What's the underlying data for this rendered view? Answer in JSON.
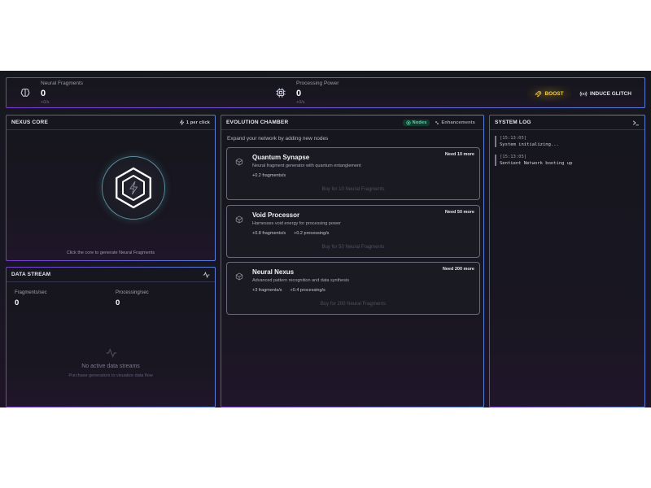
{
  "stats": {
    "fragments": {
      "label": "Neural Fragments",
      "value": "0",
      "rate": "+0/s",
      "icon": "brain-icon"
    },
    "power": {
      "label": "Processing Power",
      "value": "0",
      "rate": "+0/s",
      "icon": "cpu-icon"
    }
  },
  "actions": {
    "boost": "BOOST",
    "glitch": "INDUCE GLITCH"
  },
  "nexus_core": {
    "title": "NEXUS CORE",
    "per_click": "1 per click",
    "hint": "Click the core to generate Neural Fragments"
  },
  "data_stream": {
    "title": "DATA STREAM",
    "fragments_label": "Fragments/sec",
    "fragments_value": "0",
    "processing_label": "Processing/sec",
    "processing_value": "0",
    "empty_title": "No active data streams",
    "empty_sub": "Purchase generators to visualize data flow"
  },
  "evolution": {
    "title": "EVOLUTION CHAMBER",
    "tabs": {
      "nodes": "Nodes",
      "enhancements": "Enhancements"
    },
    "subtitle": "Expand your network by adding new nodes",
    "nodes": [
      {
        "name": "Quantum Synapse",
        "desc": "Neural fragment generator with quantum entanglement",
        "stat1": "+0.2 fragments/s",
        "stat2": "",
        "cost": "Need 10 more",
        "buy": "Buy for 10 Neural Fragments"
      },
      {
        "name": "Void Processor",
        "desc": "Harnesses void energy for processing power",
        "stat1": "+0.8 fragments/s",
        "stat2": "+0.2 processing/s",
        "cost": "Need 50 more",
        "buy": "Buy for 50 Neural Fragments"
      },
      {
        "name": "Neural Nexus",
        "desc": "Advanced pattern recognition and data synthesis",
        "stat1": "+3 fragments/s",
        "stat2": "+0.4 processing/s",
        "cost": "Need 200 more",
        "buy": "Buy for 200 Neural Fragments"
      }
    ]
  },
  "system_log": {
    "title": "SYSTEM LOG",
    "entries": [
      {
        "time": "[15:13:05]",
        "msg": "System initializing..."
      },
      {
        "time": "[15:13:05]",
        "msg": "Sentient Network booting up"
      }
    ]
  },
  "colors": {
    "accent_purple": "#7b3fd0",
    "accent_blue": "#5a7fd8",
    "boost": "#f2c94c",
    "nodes_tab": "#4ee0a6"
  }
}
